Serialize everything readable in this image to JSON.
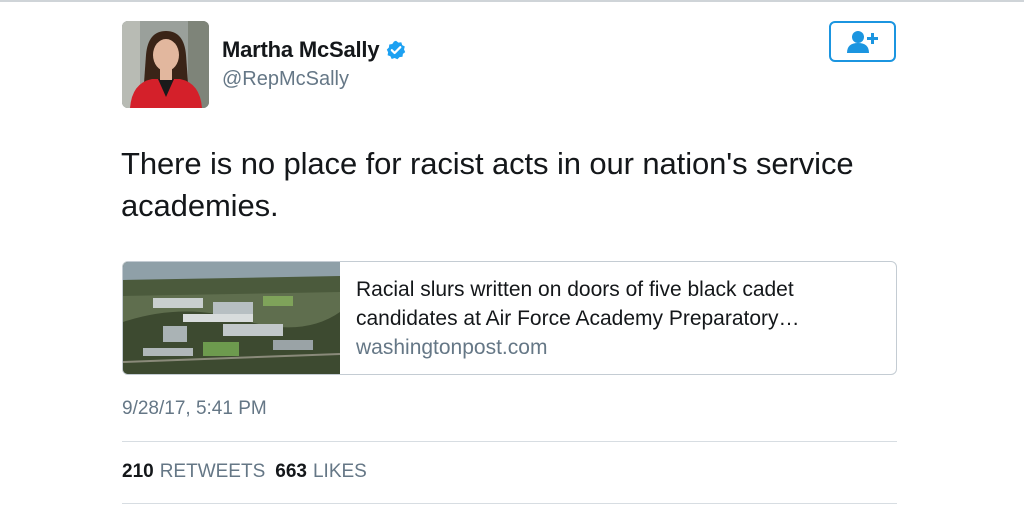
{
  "author": {
    "display_name": "Martha McSally",
    "handle": "@RepMcSally",
    "verified": true,
    "avatar_icon": "profile-photo"
  },
  "follow_button": {
    "icon": "follow-user-icon"
  },
  "tweet": {
    "text": "There is no place for racist acts in our nation's service academies."
  },
  "link_card": {
    "title": "Racial slurs written on doors of five black cadet candidates at Air Force Academy Preparatory…",
    "domain": "washingtonpost.com",
    "thumbnail_icon": "aerial-campus-photo"
  },
  "timestamp": "9/28/17, 5:41 PM",
  "stats": {
    "retweets_count": "210",
    "retweets_label": "RETWEETS",
    "likes_count": "663",
    "likes_label": "LIKES"
  },
  "colors": {
    "accent": "#1b95e0",
    "verified_badge": "#1da1f2",
    "text_primary": "#14171a",
    "text_secondary": "#657786"
  }
}
